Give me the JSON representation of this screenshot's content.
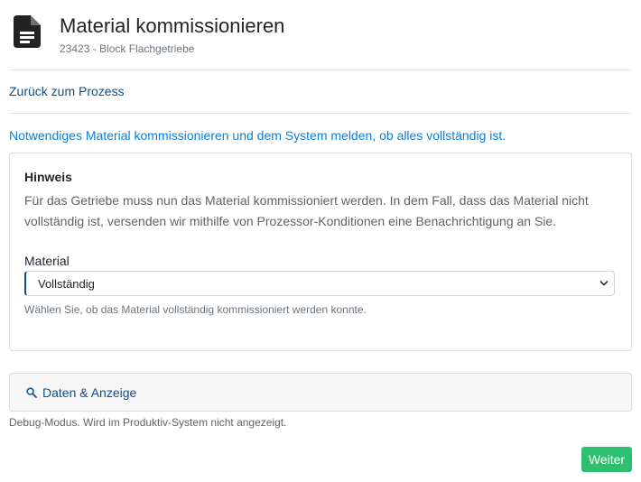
{
  "header": {
    "title": "Material kommissionieren",
    "subtitle": "23423 - Block Flachgetriebe",
    "icon": "document-icon"
  },
  "nav": {
    "back_label": "Zurück zum Prozess"
  },
  "intro": "Notwendiges Material kommissionieren und dem System melden, ob alles vollständig ist.",
  "hint": {
    "title": "Hinweis",
    "text": "Für das Getriebe muss nun das Material kommissioniert werden. In dem Fall, dass das Material nicht vollständig ist, versenden wir mithilfe von Prozessor-Konditionen eine Benachrichtigung an Sie."
  },
  "form": {
    "material_label": "Material",
    "material_value": "Vollständig",
    "material_help": "Wählen Sie, ob das Material vollständig kommissioniert werden konnte."
  },
  "accordion": {
    "label": "Daten & Anzeige",
    "icon": "search-icon"
  },
  "debug_note": "Debug-Modus. Wird im Produktiv-System nicht angezeigt.",
  "actions": {
    "next_label": "Weiter"
  },
  "colors": {
    "accent": "#0d4e8c",
    "intro_text": "#0d7fd8",
    "success": "#2fbf71"
  }
}
